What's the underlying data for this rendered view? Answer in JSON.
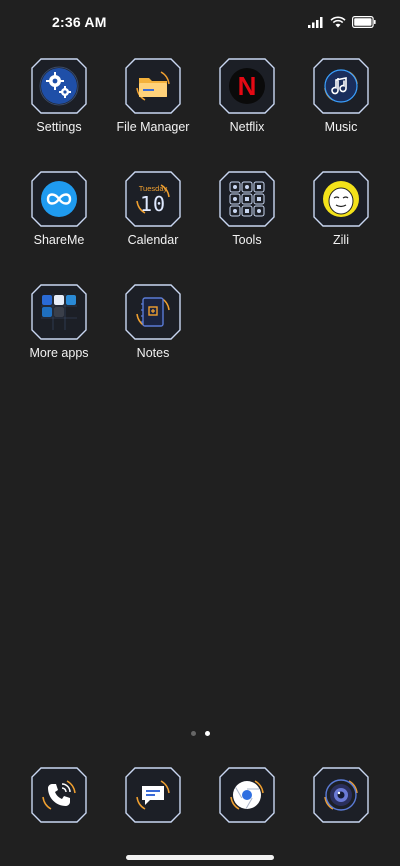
{
  "status_bar": {
    "time": "2:36 AM",
    "icons": [
      "signal-icon",
      "wifi-icon",
      "battery-icon"
    ]
  },
  "apps": [
    {
      "label": "Settings",
      "icon": "gear-icon"
    },
    {
      "label": "File Manager",
      "icon": "folder-icon"
    },
    {
      "label": "Netflix",
      "icon": "netflix-icon",
      "glyph_text": "N"
    },
    {
      "label": "Music",
      "icon": "music-note-icon"
    },
    {
      "label": "ShareMe",
      "icon": "infinity-icon"
    },
    {
      "label": "Calendar",
      "icon": "calendar-icon",
      "day_text": "Tuesday",
      "date_text": "10"
    },
    {
      "label": "Tools",
      "icon": "tools-folder-icon"
    },
    {
      "label": "Zili",
      "icon": "zili-face-icon"
    },
    {
      "label": "More apps",
      "icon": "apps-folder-icon"
    },
    {
      "label": "Notes",
      "icon": "notes-icon"
    }
  ],
  "pager": {
    "count": 2,
    "active_index": 1
  },
  "dock": [
    {
      "icon": "phone-icon"
    },
    {
      "icon": "message-icon"
    },
    {
      "icon": "chrome-icon"
    },
    {
      "icon": "camera-icon"
    }
  ],
  "colors": {
    "background": "#202020",
    "frame": "#c9d7f2",
    "accent_orange": "#f0a030",
    "accent_blue": "#3aa0ff",
    "netflix_red": "#e50914",
    "zili_yellow": "#f3e21a"
  }
}
